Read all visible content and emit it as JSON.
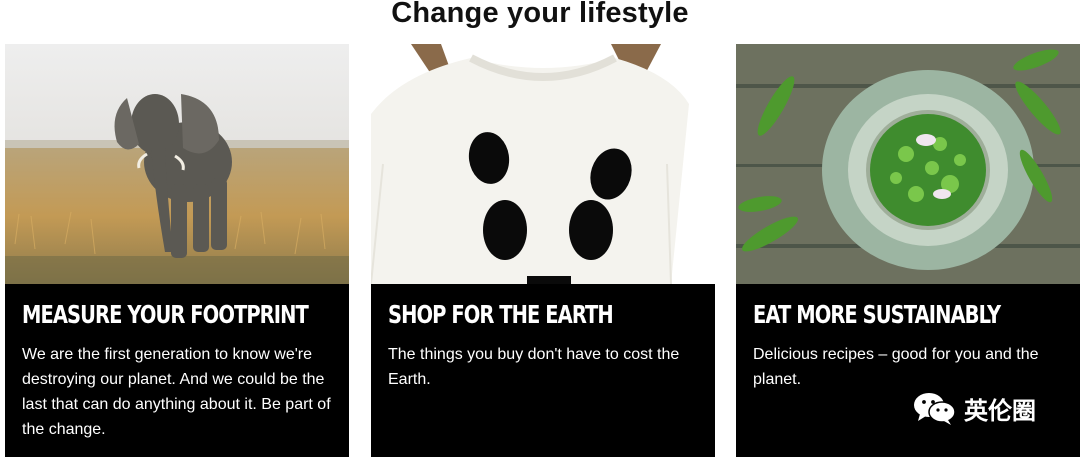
{
  "page": {
    "title": "Change your lifestyle"
  },
  "cards": [
    {
      "heading": "MEASURE YOUR FOOTPRINT",
      "body": "We are the first generation to know we're destroying our planet. And we could be the last that can do anything about it. Be part of the change.",
      "image": "elephant-photo"
    },
    {
      "heading": "SHOP FOR THE EARTH",
      "body": "The things you buy don't have to cost the Earth.",
      "image": "panda-sweater-photo"
    },
    {
      "heading": "EAT MORE SUSTAINABLY",
      "body": "Delicious recipes – good for you and the planet.",
      "image": "green-peas-bowl-photo"
    }
  ],
  "watermark": {
    "icon": "wechat-icon",
    "text": "英伦圈"
  },
  "colors": {
    "card_background": "#000000",
    "card_text": "#ffffff",
    "title_text": "#111111"
  }
}
